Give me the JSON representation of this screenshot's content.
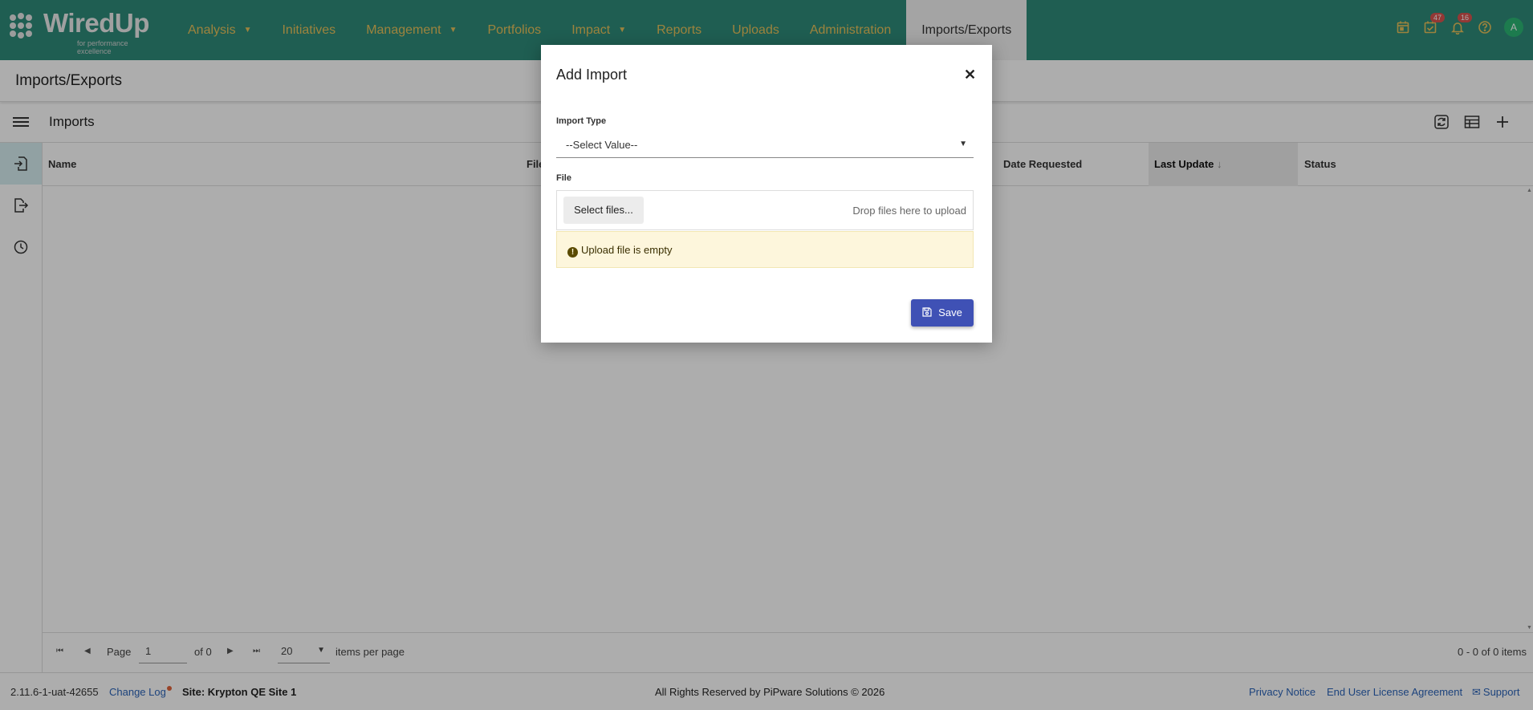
{
  "logo": {
    "name": "WiredUp",
    "tagline": "for performance excellence"
  },
  "nav": {
    "items": [
      {
        "label": "Analysis",
        "caret": true
      },
      {
        "label": "Initiatives",
        "caret": false
      },
      {
        "label": "Management",
        "caret": true
      },
      {
        "label": "Portfolios",
        "caret": false
      },
      {
        "label": "Impact",
        "caret": true
      },
      {
        "label": "Reports",
        "caret": false
      },
      {
        "label": "Uploads",
        "caret": false
      },
      {
        "label": "Administration",
        "caret": false
      },
      {
        "label": "Imports/Exports",
        "caret": false,
        "active": true
      }
    ],
    "badges": {
      "tasks": "47",
      "notifications": "16"
    },
    "avatar": "A"
  },
  "page": {
    "title": "Imports/Exports"
  },
  "toolbar": {
    "section_title": "Imports"
  },
  "grid": {
    "columns": [
      "Name",
      "File",
      "Date Requested",
      "Last Update",
      "Status"
    ],
    "sorted_column": "Last Update",
    "sort_indicator": "↓"
  },
  "pager": {
    "page_label": "Page",
    "page_value": "1",
    "of_label": "of 0",
    "page_size": "20",
    "items_per_page_label": "items per page",
    "range_text": "0 - 0 of 0 items"
  },
  "statusbar": {
    "version": "2.11.6-1-uat-42655",
    "change_log": "Change Log",
    "site": "Site: Krypton QE Site 1",
    "copyright": "All Rights Reserved by PiPware Solutions © 2026",
    "privacy": "Privacy Notice",
    "eula": "End User License Agreement",
    "support": "Support"
  },
  "modal": {
    "title": "Add Import",
    "import_type_label": "Import Type",
    "import_type_value": "--Select Value--",
    "file_label": "File",
    "select_files": "Select files...",
    "drop_hint": "Drop files here to upload",
    "warning": "Upload file is empty",
    "save": "Save"
  },
  "colors": {
    "nav_bg": "#2e8b7a",
    "nav_text": "#e8c15a",
    "primary": "#3f51b5",
    "warning_bg": "#fdf6dc",
    "link": "#2b64b8"
  }
}
